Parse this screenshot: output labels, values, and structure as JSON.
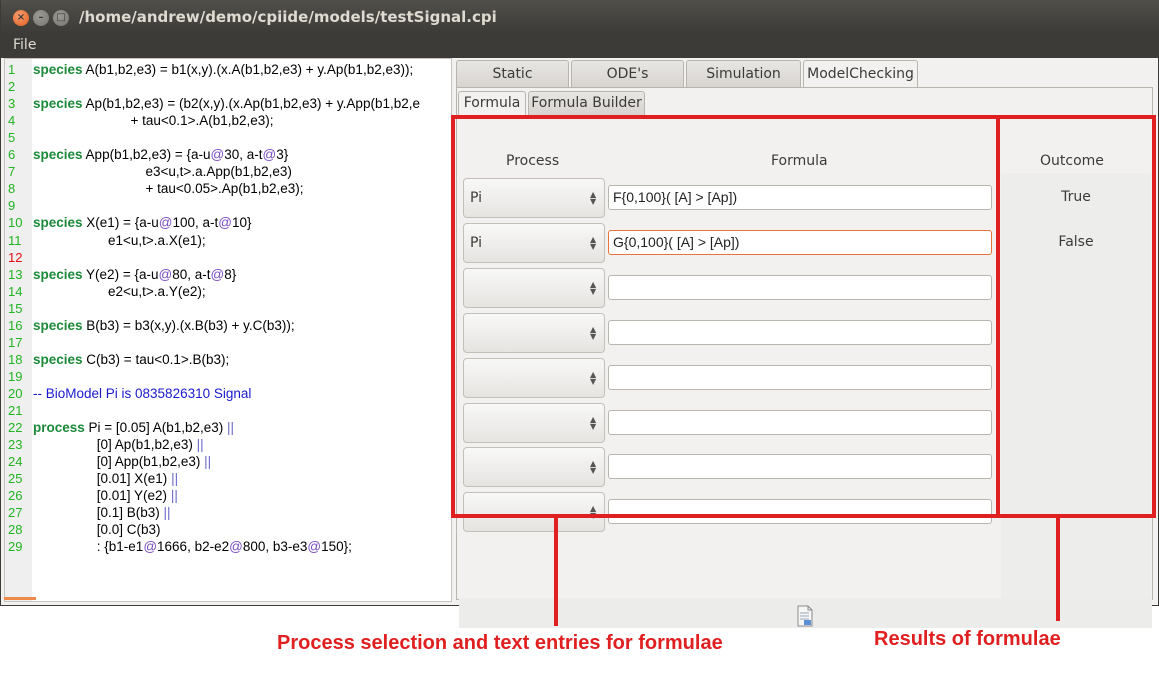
{
  "window": {
    "title": "/home/andrew/demo/cpiide/models/testSignal.cpi",
    "menu_file": "File"
  },
  "editor": {
    "lines": [
      {
        "n": "1",
        "parts": [
          [
            "kw",
            "species"
          ],
          [
            "t",
            " A(b1,b2,e3) = b1(x,y).(x.A(b1,b2,e3) + y.Ap(b1,b2,e3));"
          ]
        ]
      },
      {
        "n": "2",
        "parts": []
      },
      {
        "n": "3",
        "parts": [
          [
            "kw",
            "species"
          ],
          [
            "t",
            " Ap(b1,b2,e3) = (b2(x,y).(x.Ap(b1,b2,e3) + y.App(b1,b2,e"
          ]
        ]
      },
      {
        "n": "4",
        "parts": [
          [
            "t",
            "                          + tau<0.1>.A(b1,b2,e3);"
          ]
        ]
      },
      {
        "n": "5",
        "parts": []
      },
      {
        "n": "6",
        "parts": [
          [
            "kw",
            "species"
          ],
          [
            "t",
            " App(b1,b2,e3) = {a-u"
          ],
          [
            "at",
            "@"
          ],
          [
            "t",
            "30, a-t"
          ],
          [
            "at",
            "@"
          ],
          [
            "t",
            "3}"
          ]
        ]
      },
      {
        "n": "7",
        "parts": [
          [
            "t",
            "                              e3<u,t>.a.App(b1,b2,e3)"
          ]
        ]
      },
      {
        "n": "8",
        "parts": [
          [
            "t",
            "                              + tau<0.05>.Ap(b1,b2,e3);"
          ]
        ]
      },
      {
        "n": "9",
        "parts": []
      },
      {
        "n": "10",
        "parts": [
          [
            "kw",
            "species"
          ],
          [
            "t",
            " X(e1) = {a-u"
          ],
          [
            "at",
            "@"
          ],
          [
            "t",
            "100, a-t"
          ],
          [
            "at",
            "@"
          ],
          [
            "t",
            "10}"
          ]
        ]
      },
      {
        "n": "11",
        "parts": [
          [
            "t",
            "                    e1<u,t>.a.X(e1);"
          ]
        ]
      },
      {
        "n": "12",
        "err": true,
        "parts": []
      },
      {
        "n": "13",
        "parts": [
          [
            "kw",
            "species"
          ],
          [
            "t",
            " Y(e2) = {a-u"
          ],
          [
            "at",
            "@"
          ],
          [
            "t",
            "80, a-t"
          ],
          [
            "at",
            "@"
          ],
          [
            "t",
            "8}"
          ]
        ]
      },
      {
        "n": "14",
        "parts": [
          [
            "t",
            "                    e2<u,t>.a.Y(e2);"
          ]
        ]
      },
      {
        "n": "15",
        "parts": []
      },
      {
        "n": "16",
        "parts": [
          [
            "kw",
            "species"
          ],
          [
            "t",
            " B(b3) = b3(x,y).(x.B(b3) + y.C(b3));"
          ]
        ]
      },
      {
        "n": "17",
        "parts": []
      },
      {
        "n": "18",
        "parts": [
          [
            "kw",
            "species"
          ],
          [
            "t",
            " C(b3) = tau<0.1>.B(b3);"
          ]
        ]
      },
      {
        "n": "19",
        "parts": []
      },
      {
        "n": "20",
        "parts": [
          [
            "cmt",
            "-- BioModel Pi is 0835826310 Signal"
          ]
        ]
      },
      {
        "n": "21",
        "parts": []
      },
      {
        "n": "22",
        "parts": [
          [
            "kw",
            "process"
          ],
          [
            "t",
            " Pi = [0.05] A(b1,b2,e3) "
          ],
          [
            "pipe",
            "||"
          ]
        ]
      },
      {
        "n": "23",
        "parts": [
          [
            "t",
            "                 [0] Ap(b1,b2,e3) "
          ],
          [
            "pipe",
            "||"
          ]
        ]
      },
      {
        "n": "24",
        "parts": [
          [
            "t",
            "                 [0] App(b1,b2,e3) "
          ],
          [
            "pipe",
            "||"
          ]
        ]
      },
      {
        "n": "25",
        "parts": [
          [
            "t",
            "                 [0.01] X(e1) "
          ],
          [
            "pipe",
            "||"
          ]
        ]
      },
      {
        "n": "26",
        "parts": [
          [
            "t",
            "                 [0.01] Y(e2) "
          ],
          [
            "pipe",
            "||"
          ]
        ]
      },
      {
        "n": "27",
        "parts": [
          [
            "t",
            "                 [0.1] B(b3) "
          ],
          [
            "pipe",
            "||"
          ]
        ]
      },
      {
        "n": "28",
        "parts": [
          [
            "t",
            "                 [0.0] C(b3)"
          ]
        ]
      },
      {
        "n": "29",
        "parts": [
          [
            "t",
            "                 : {b1-e1"
          ],
          [
            "at",
            "@"
          ],
          [
            "t",
            "1666, b2-e2"
          ],
          [
            "at",
            "@"
          ],
          [
            "t",
            "800, b3-e3"
          ],
          [
            "at",
            "@"
          ],
          [
            "t",
            "150};"
          ]
        ]
      }
    ]
  },
  "tabs": {
    "main": [
      "Static",
      "ODE's",
      "Simulation",
      "ModelChecking"
    ],
    "sub": [
      "Formula",
      "Formula Builder"
    ]
  },
  "formula_table": {
    "headers": {
      "process": "Process",
      "formula": "Formula",
      "outcome": "Outcome"
    },
    "rows": [
      {
        "process": "Pi",
        "formula": "F{0,100}( [A] > [Ap])",
        "outcome": "True"
      },
      {
        "process": "Pi",
        "formula": "G{0,100}( [A] > [Ap])",
        "outcome": "False"
      },
      {
        "process": "",
        "formula": "",
        "outcome": ""
      },
      {
        "process": "",
        "formula": "",
        "outcome": ""
      },
      {
        "process": "",
        "formula": "",
        "outcome": ""
      },
      {
        "process": "",
        "formula": "",
        "outcome": ""
      },
      {
        "process": "",
        "formula": "",
        "outcome": ""
      },
      {
        "process": "",
        "formula": "",
        "outcome": ""
      }
    ]
  },
  "annotations": {
    "left_caption": "Process selection and text entries for formulae",
    "right_caption": "Results of formulae",
    "color": "#e02020"
  }
}
